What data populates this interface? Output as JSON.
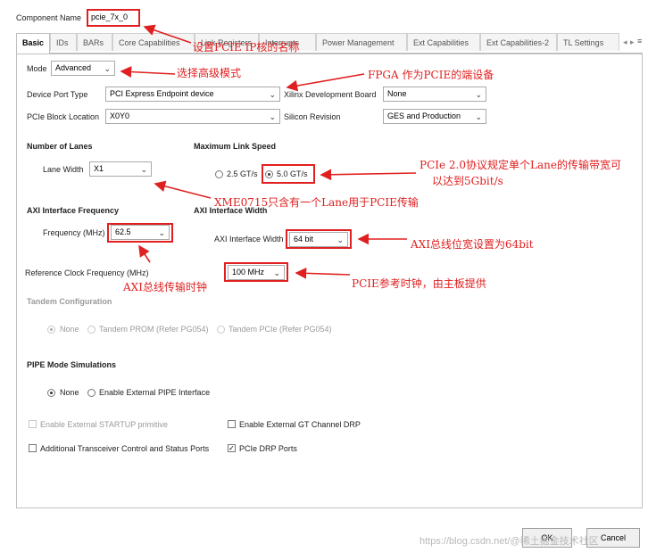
{
  "component": {
    "label": "Component Name",
    "value": "pcie_7x_0"
  },
  "tabs": [
    {
      "label": "Basic",
      "active": true
    },
    {
      "label": "IDs"
    },
    {
      "label": "BARs"
    },
    {
      "label": "Core Capabilities"
    },
    {
      "label": "Link Registers"
    },
    {
      "label": "Interrupts"
    },
    {
      "label": "Power Management"
    },
    {
      "label": "Ext Capabilities"
    },
    {
      "label": "Ext Capabilities-2"
    },
    {
      "label": "TL Settings"
    }
  ],
  "tab_scroll": {
    "left": "◂",
    "right": "▸",
    "menu": "≡"
  },
  "basic": {
    "mode_label": "Mode",
    "mode_value": "Advanced",
    "device_port_label": "Device Port Type",
    "device_port_value": "PCI Express Endpoint device",
    "xdb_label": "Xilinx Development Board",
    "xdb_value": "None",
    "block_loc_label": "PCIe Block Location",
    "block_loc_value": "X0Y0",
    "silicon_label": "Silicon Revision",
    "silicon_value": "GES and Production"
  },
  "lanes": {
    "heading": "Number of Lanes",
    "label": "Lane Width",
    "value": "X1"
  },
  "speed": {
    "heading": "Maximum Link Speed",
    "opt1": "2.5 GT/s",
    "opt2": "5.0 GT/s"
  },
  "axi_freq": {
    "heading": "AXI Interface Frequency",
    "label": "Frequency (MHz)",
    "value": "62.5"
  },
  "axi_width": {
    "heading": "AXI Interface Width",
    "label": "AXI Interface Width",
    "value": "64 bit"
  },
  "refclk": {
    "label": "Reference Clock Frequency (MHz)",
    "value": "100 MHz"
  },
  "tandem": {
    "heading": "Tandem Configuration",
    "opt1": "None",
    "opt2": "Tandem PROM (Refer PG054)",
    "opt3": "Tandem PCIe (Refer PG054)"
  },
  "pipe": {
    "heading": "PIPE Mode Simulations",
    "opt1": "None",
    "opt2": "Enable External PIPE Interface"
  },
  "checks": {
    "startup": "Enable External STARTUP primitive",
    "gt_drp": "Enable External GT Channel DRP",
    "transceiver": "Additional Transceiver Control and Status Ports",
    "pcie_drp": "PCIe DRP Ports"
  },
  "buttons": {
    "ok": "OK",
    "cancel": "Cancel"
  },
  "annotations": {
    "a1": "设置PCIE IP核的名称",
    "a2": "选择高级模式",
    "a3": "FPGA 作为PCIE的端设备",
    "a4": "PCIe 2.0协议规定单个Lane的传输带宽可",
    "a5": "以达到5Gbit/s",
    "a6": "XME0715只含有一个Lane用于PCIE传输",
    "a7": "AXI总线位宽设置为64bit",
    "a8": "PCIE参考时钟，由主板提供",
    "a9": "AXI总线传输时钟"
  },
  "watermark": "https://blog.csdn.net/@稀土掘金技术社区",
  "colors": {
    "annotation": "#e02020",
    "panel_border": "#bfbfbf"
  }
}
